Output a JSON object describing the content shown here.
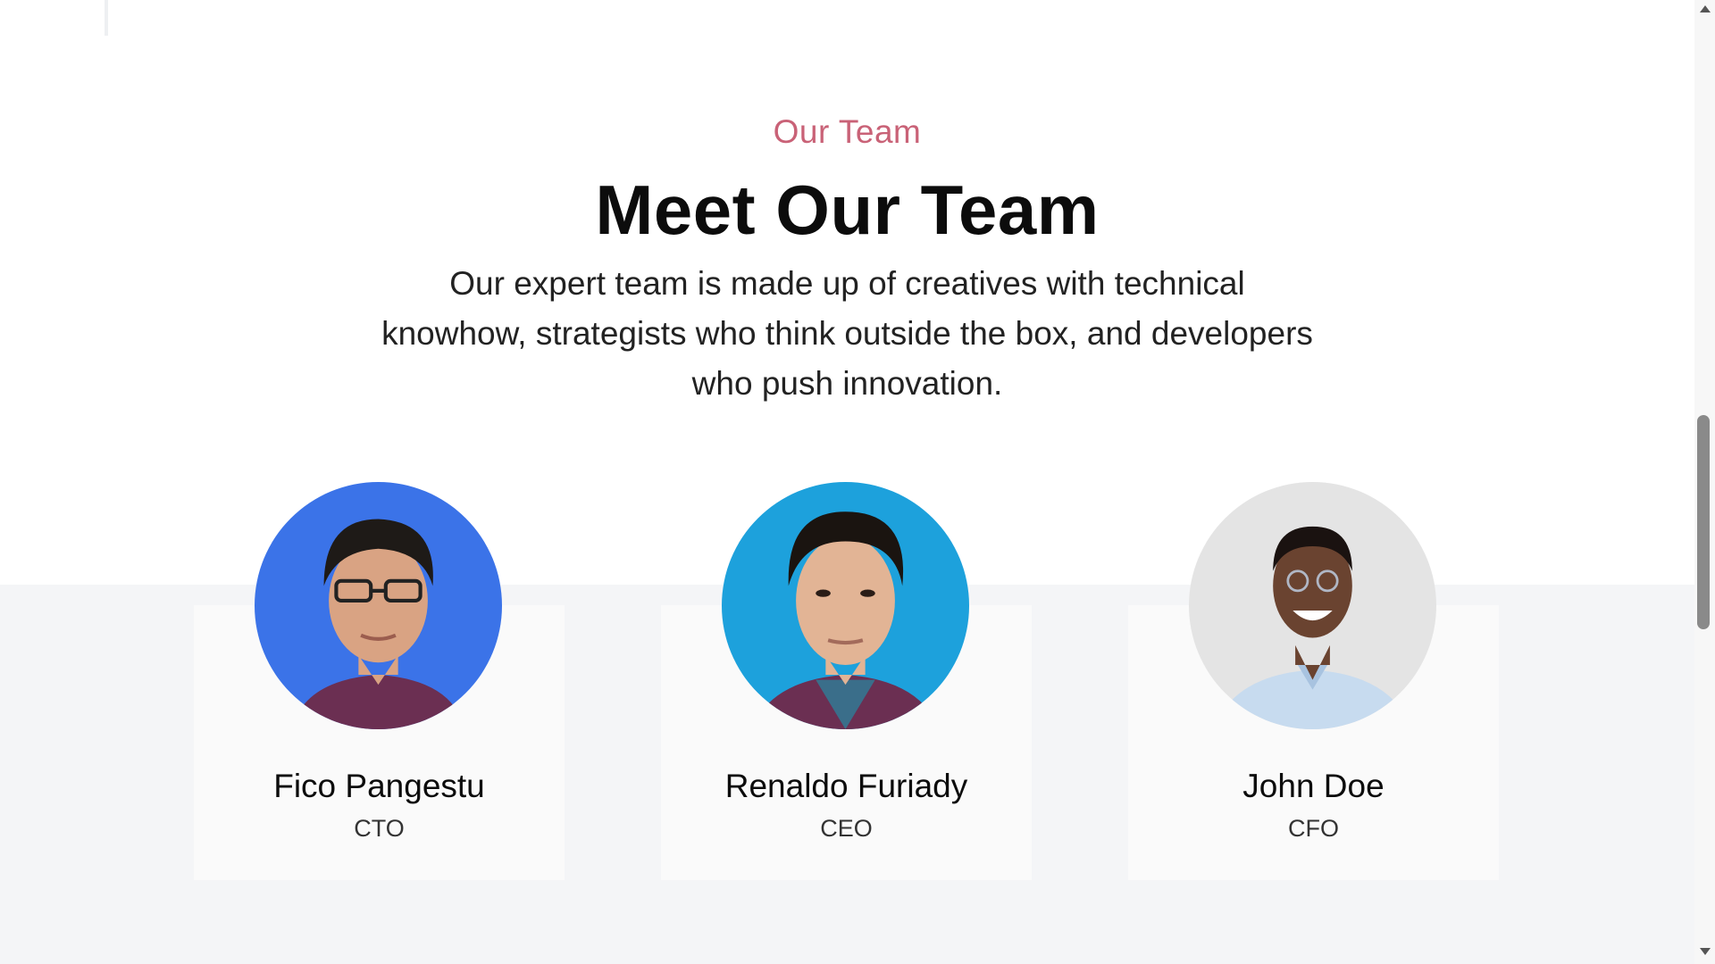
{
  "section": {
    "eyebrow": "Our Team",
    "title": "Meet Our Team",
    "description": "Our expert team is made up of creatives with technical knowhow, strategists who think outside the box, and developers who push innovation."
  },
  "team": [
    {
      "name": "Fico Pangestu",
      "role": "CTO",
      "photo_bg": "#3b73e8"
    },
    {
      "name": "Renaldo Furiady",
      "role": "CEO",
      "photo_bg": "#1da1dc"
    },
    {
      "name": "John Doe",
      "role": "CFO",
      "photo_bg": "#e4e4e4"
    }
  ],
  "colors": {
    "accent": "#c96277",
    "band": "#f4f5f7",
    "card": "#fafafa"
  }
}
